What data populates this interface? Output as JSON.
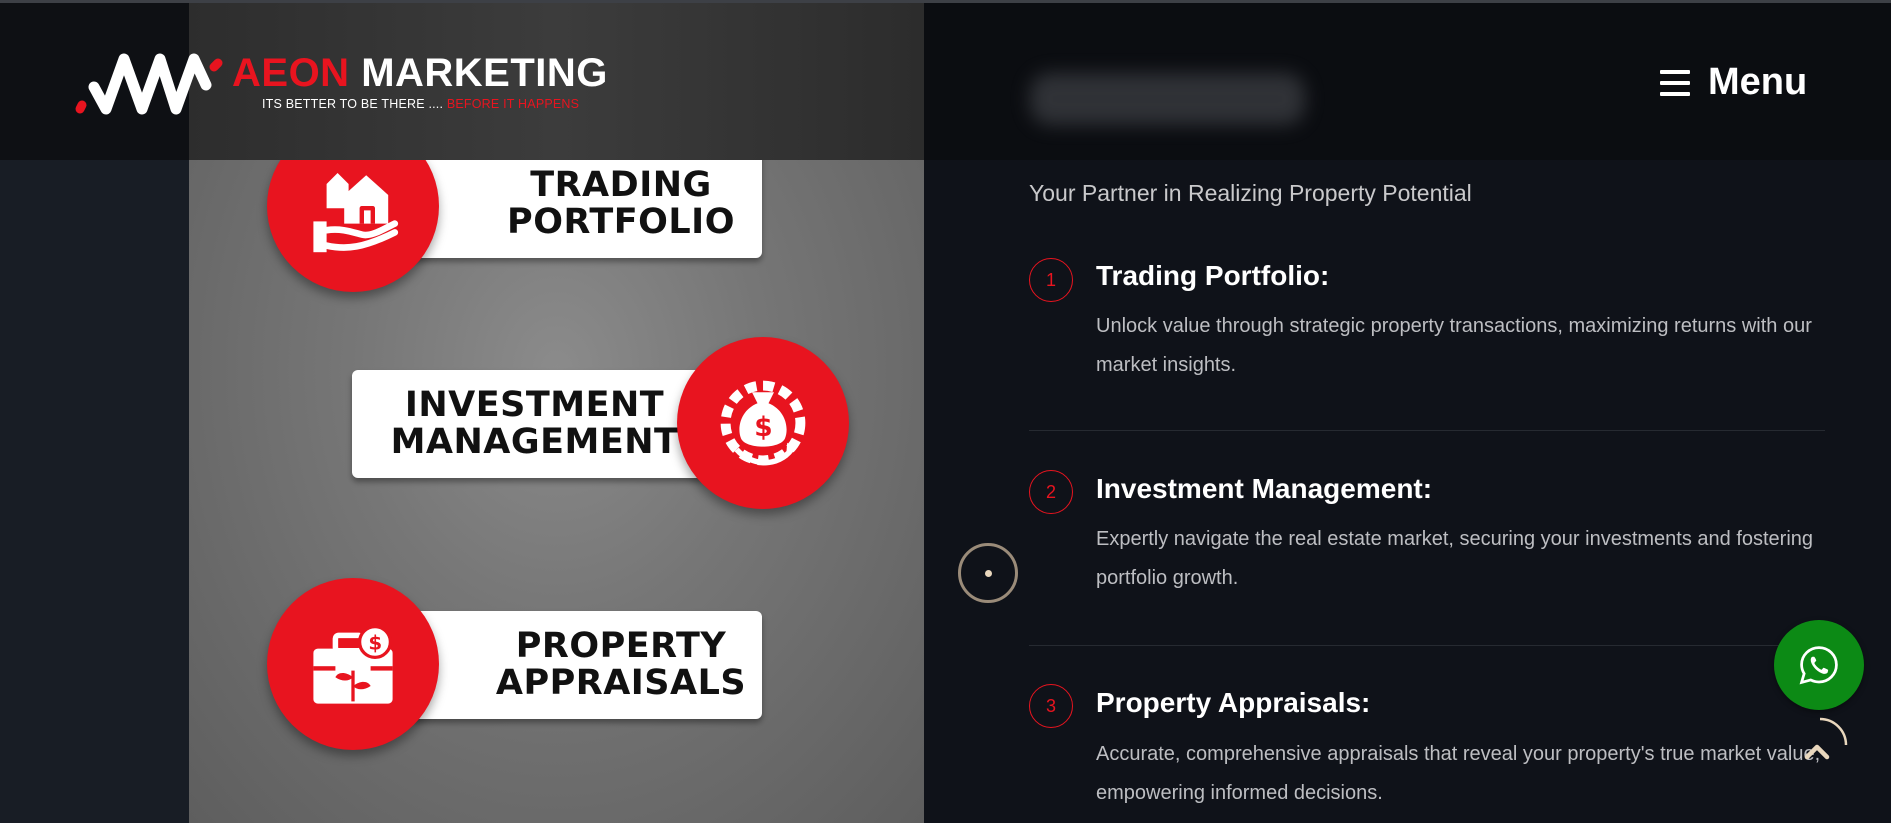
{
  "brand": {
    "name_part1": "AEON",
    "name_part2": "MARKETING",
    "tagline_part1": "ITS BETTER TO BE THERE ....",
    "tagline_part2": "BEFORE IT HAPPENS"
  },
  "header": {
    "menu_label": "Menu"
  },
  "services_image": {
    "cards": [
      {
        "line1": "TRADING",
        "line2": "PORTFOLIO",
        "icon": "house-in-hand-icon"
      },
      {
        "line1": "INVESTMENT",
        "line2": "MANAGEMENT",
        "icon": "money-bag-gear-icon"
      },
      {
        "line1": "PROPERTY",
        "line2": "APPRAISALS",
        "icon": "briefcase-growth-icon"
      }
    ]
  },
  "section": {
    "subtitle": "Your Partner in Realizing Property Potential",
    "features": [
      {
        "number": "1",
        "title": "Trading Portfolio:",
        "description": "Unlock value through strategic property transactions, maximizing returns with our market insights."
      },
      {
        "number": "2",
        "title": "Investment Management:",
        "description": "Expertly navigate the real estate market, securing your investments and fostering portfolio growth."
      },
      {
        "number": "3",
        "title": "Property Appraisals:",
        "description": "Accurate, comprehensive appraisals that reveal your property's true market value, empowering informed decisions."
      }
    ]
  },
  "colors": {
    "accent": "#e8141f",
    "whatsapp": "#0c8a15",
    "background": "#0f1219"
  }
}
